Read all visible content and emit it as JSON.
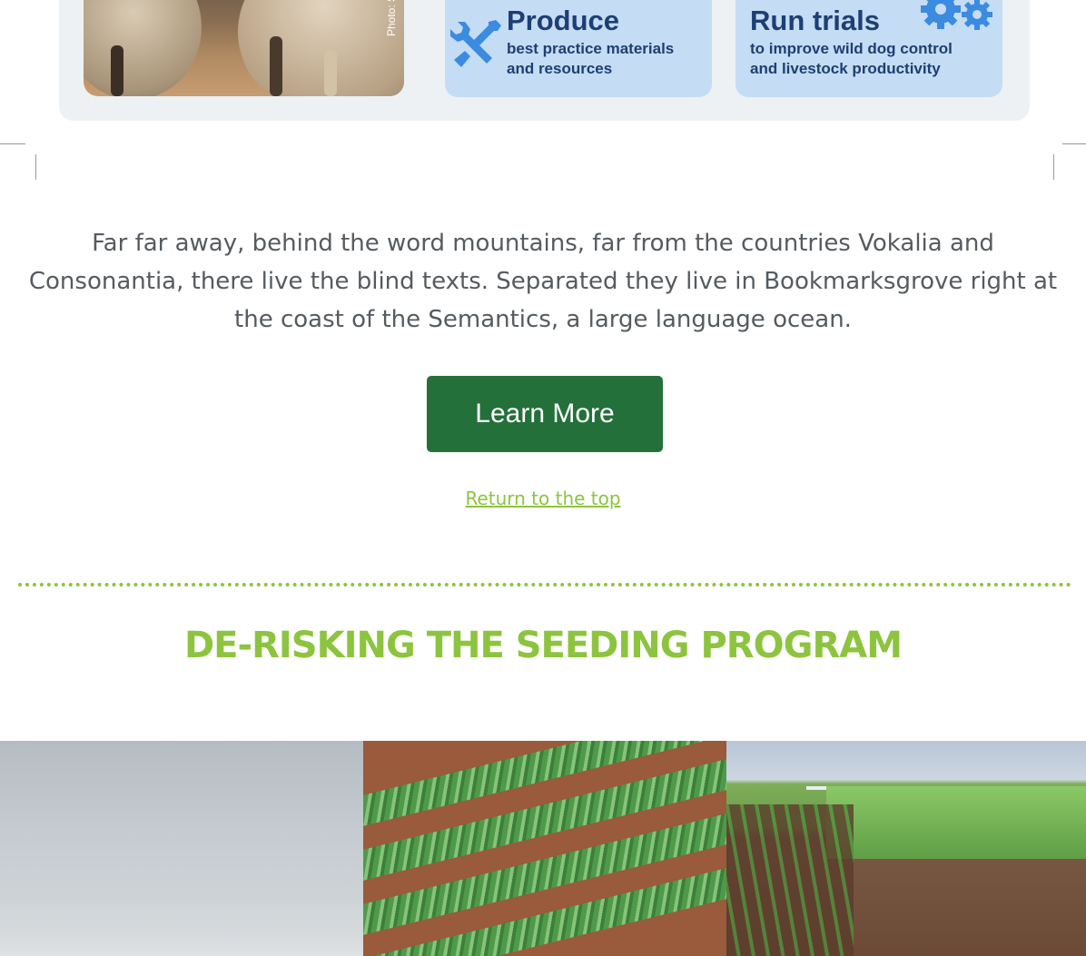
{
  "infographic": {
    "photo_credit": "Photo: Ste",
    "cards": [
      {
        "title": "Produce",
        "subtitle_line1": "best practice materials",
        "subtitle_line2": "and resources",
        "icon": "wrench-screwdriver-icon"
      },
      {
        "title": "Run trials",
        "subtitle_line1": "to improve wild dog control",
        "subtitle_line2": "and livestock productivity",
        "icon": "gears-icon"
      }
    ]
  },
  "content": {
    "paragraph": "Far far away, behind the word mountains, far from the countries Vokalia and Consonantia, there live the blind texts. Separated they live in Bookmarksgrove right at the coast of the Semantics, a large language ocean.",
    "button_label": "Learn More",
    "return_link": "Return to the top"
  },
  "section": {
    "title": "DE-RISKING THE SEEDING PROGRAM"
  },
  "colors": {
    "accent_green": "#8dc43f",
    "button_green": "#24703a",
    "card_blue": "#c5dcf5",
    "card_text": "#1e3f73",
    "panel_bg": "#edf1f4"
  }
}
